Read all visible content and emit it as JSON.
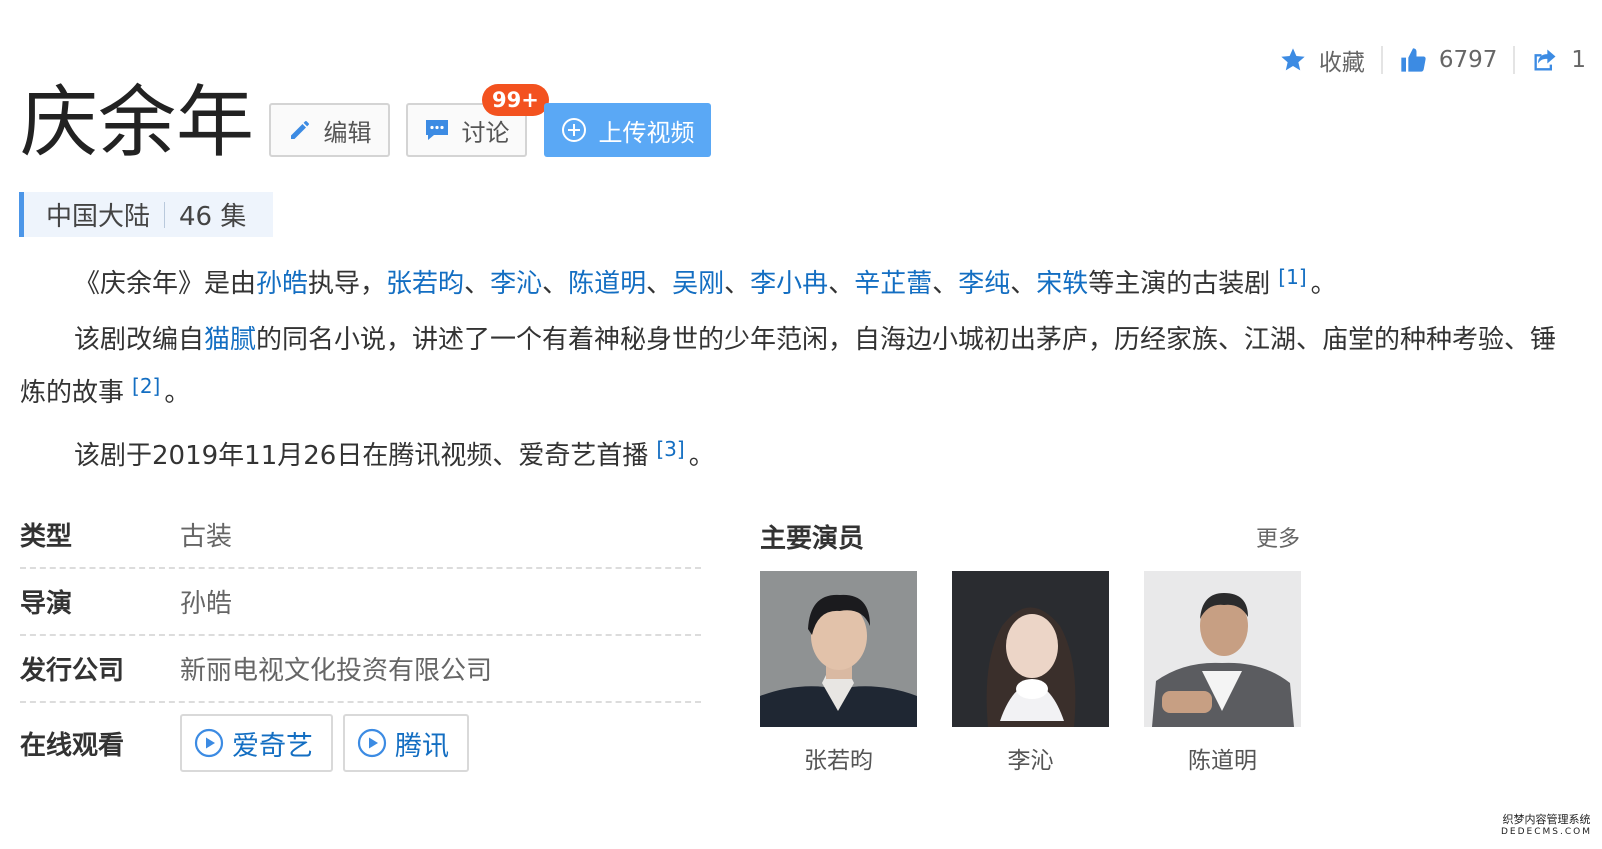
{
  "actions": {
    "favorite_label": "收藏",
    "like_count": "6797",
    "share_count": "1"
  },
  "title": "庆余年",
  "buttons": {
    "edit": "编辑",
    "discuss": "讨论",
    "discuss_badge": "99+",
    "upload": "上传视频"
  },
  "tags": {
    "region": "中国大陆",
    "episodes": "46 集"
  },
  "summary": {
    "p1_prefix": "《庆余年》是由",
    "director_link": "孙皓",
    "p1_mid": "执导，",
    "cast_links": [
      "张若昀",
      "李沁",
      "陈道明",
      "吴刚",
      "李小冉",
      "辛芷蕾",
      "李纯",
      "宋轶"
    ],
    "separator": "、",
    "p1_suffix": "等主演的古装剧",
    "ref1": "[1]",
    "period": "。",
    "p2_prefix": "该剧改编自",
    "author_link": "猫腻",
    "p2_suffix": "的同名小说，讲述了一个有着神秘身世的少年范闲，自海边小城初出茅庐，历经家族、江湖、庙堂的种种考验、锤炼的故事",
    "ref2": "[2]",
    "p3_text": "该剧于2019年11月26日在腾讯视频、爱奇艺首播",
    "ref3": "[3]"
  },
  "info": {
    "genre_label": "类型",
    "genre_value": "古装",
    "director_label": "导演",
    "director_value": "孙皓",
    "company_label": "发行公司",
    "company_value": "新丽电视文化投资有限公司",
    "watch_label": "在线观看",
    "platforms": [
      "爱奇艺",
      "腾讯"
    ]
  },
  "cast": {
    "title": "主要演员",
    "more": "更多",
    "actors": [
      "张若昀",
      "李沁",
      "陈道明"
    ]
  },
  "watermark": {
    "line1": "织梦内容管理系统",
    "line2": "DEDECMS.COM"
  },
  "colors": {
    "link": "#136ec2",
    "accent": "#4c96e8",
    "upload_button": "#5aa8f5",
    "badge": "#f3521f"
  },
  "icons": {
    "favorite": "star-icon",
    "like": "thumbs-up-icon",
    "share": "share-icon",
    "edit": "pencil-icon",
    "discuss": "chat-bubble-icon",
    "upload": "plus-circle-icon",
    "play": "play-circle-icon"
  }
}
